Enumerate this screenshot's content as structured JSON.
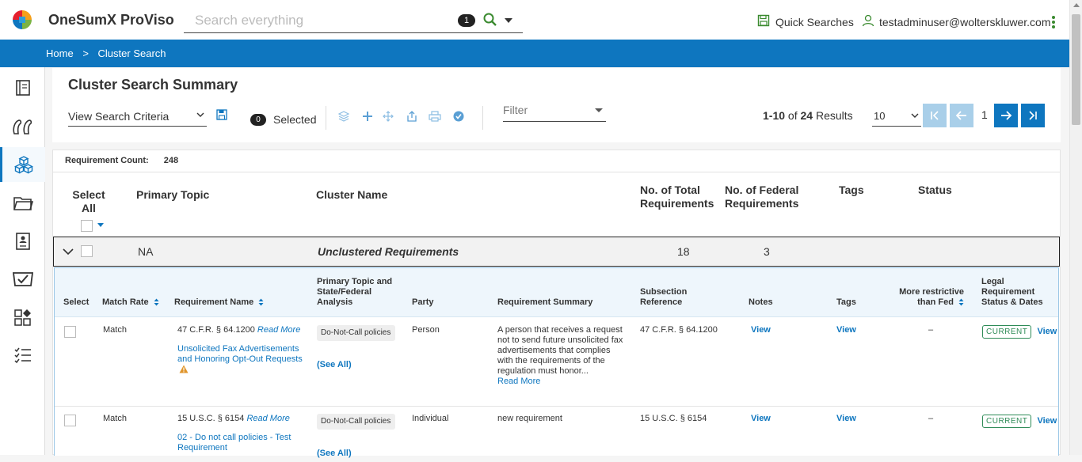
{
  "app": {
    "title": "OneSumX ProViso"
  },
  "search": {
    "placeholder": "Search everything",
    "count": "1"
  },
  "header": {
    "quick_searches": "Quick Searches",
    "user": "testadminuser@wolterskluwer.com"
  },
  "breadcrumb": {
    "home": "Home",
    "sep": ">",
    "current": "Cluster Search"
  },
  "page": {
    "title": "Cluster Search Summary",
    "view_criteria": "View Search Criteria",
    "selected_count": "0",
    "selected_label": "Selected",
    "filter_placeholder": "Filter",
    "results_range": "1-10",
    "results_of": "of",
    "results_total": "24",
    "results_label": "Results",
    "page_size": "10",
    "current_page": "1"
  },
  "summary": {
    "req_count_label": "Requirement Count:",
    "req_count_value": "248",
    "columns": {
      "select_all": "Select All",
      "primary_topic": "Primary Topic",
      "cluster_name": "Cluster Name",
      "total_reqs": "No. of Total Requirements",
      "federal_reqs": "No. of Federal Requirements",
      "tags": "Tags",
      "status": "Status"
    },
    "group": {
      "primary_topic": "NA",
      "cluster_name": "Unclustered Requirements",
      "total": "18",
      "federal": "3"
    }
  },
  "detail": {
    "columns": {
      "select": "Select",
      "match_rate": "Match Rate",
      "req_name": "Requirement Name",
      "primary_topic": "Primary Topic and State/Federal Analysis",
      "party": "Party",
      "summary": "Requirement Summary",
      "subsection": "Subsection Reference",
      "notes": "Notes",
      "tags": "Tags",
      "more_restrictive": "More restrictive than Fed",
      "legal_status": "Legal Requirement Status & Dates"
    },
    "rows": [
      {
        "match": "Match",
        "citation": "47 C.F.R. § 64.1200",
        "read_more": "Read More",
        "req_name": "Unsolicited Fax Advertisements and Honoring Opt-Out Requests",
        "topic": "Do-Not-Call policies",
        "see_all": "(See All)",
        "party": "Person",
        "summary": "A person that receives a request not to send future unsolicited fax advertisements that complies with the requirements of the regulation must honor...",
        "summary_more": "Read More",
        "subsection": "47 C.F.R. § 64.1200",
        "notes": "View",
        "tags": "View",
        "more_restrictive": "–",
        "status": "CURRENT",
        "status_view": "View"
      },
      {
        "match": "Match",
        "citation": "15 U.S.C. § 6154",
        "read_more": "Read More",
        "req_name": "02 - Do not call policies - Test Requirement",
        "topic": "Do-Not-Call policies",
        "see_all": "(See All)",
        "party": "Individual",
        "summary": "new requirement",
        "subsection": "15 U.S.C. § 6154",
        "notes": "View",
        "tags": "View",
        "more_restrictive": "–",
        "status": "CURRENT",
        "status_view": "View"
      }
    ]
  },
  "colors": {
    "brand_blue": "#0e76bf",
    "brand_green": "#3a8a2f",
    "status_green": "#2e8b57",
    "warning": "#e0952b"
  }
}
